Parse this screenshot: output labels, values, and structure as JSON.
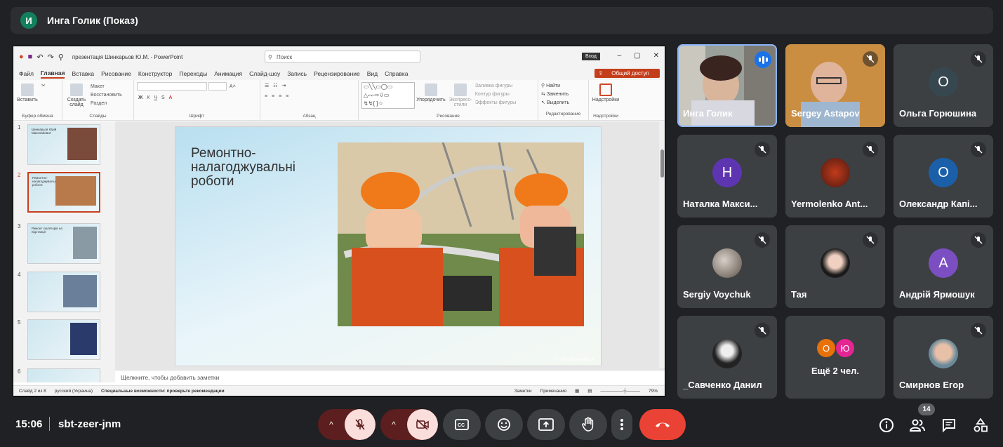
{
  "presenter_bar": {
    "avatar_letter": "И",
    "title": "Инга Голик (Показ)"
  },
  "powerpoint": {
    "doc_title": "презентація Шинкарьов Ю.М. - PowerPoint",
    "search_placeholder": "Поиск",
    "login_label": "Вход",
    "share_label": "Общий доступ",
    "menu": [
      "Файл",
      "Главная",
      "Вставка",
      "Рисование",
      "Конструктор",
      "Переходы",
      "Анимация",
      "Слайд-шоу",
      "Запись",
      "Рецензирование",
      "Вид",
      "Справка"
    ],
    "active_menu_index": 1,
    "ribbon": {
      "clipboard": {
        "paste": "Вставить",
        "label": "Буфер обмена"
      },
      "slides": {
        "create": "Создать слайд",
        "layout": "Макет",
        "restore": "Восстановить",
        "section": "Раздел",
        "label": "Слайды"
      },
      "font": {
        "label": "Шрифт"
      },
      "paragraph": {
        "label": "Абзац"
      },
      "drawing": {
        "arrange": "Упорядочить",
        "express": "Экспресс-стили",
        "fill": "Заливка фигуры",
        "outline": "Контур фигуры",
        "effects": "Эффекты фигуры",
        "label": "Рисование"
      },
      "editing": {
        "find": "Найти",
        "replace": "Заменить",
        "select": "Выделить",
        "label": "Редактирование"
      },
      "addins": {
        "btn": "Надстройки",
        "label": "Надстройки"
      }
    },
    "thumbnails": [
      {
        "num": "1",
        "text": "Шинкарьов Юрій Миколайович"
      },
      {
        "num": "2",
        "text": "Ремонтно-налагоджувальні роботи"
      },
      {
        "num": "3",
        "text": "Ремонт ізоляторів на підстанції"
      },
      {
        "num": "4",
        "text": ""
      },
      {
        "num": "5",
        "text": ""
      },
      {
        "num": "6",
        "text": ""
      }
    ],
    "selected_thumb": 1,
    "slide_title": "Ремонтно-налагоджувальні роботи",
    "watermark": "© shutterstock",
    "notes_placeholder": "Щелкните, чтобы добавить заметки",
    "status": {
      "slide": "Слайд 2 из 8",
      "lang": "русский (Украина)",
      "accessibility": "Специальные возможности: проверьте рекомендации",
      "notes": "Заметки",
      "comments": "Примечания",
      "zoom": "79%"
    }
  },
  "participants": [
    {
      "name": "Инга Голик",
      "type": "video",
      "speaking": true
    },
    {
      "name": "Sergey Astapov",
      "type": "video",
      "muted": true
    },
    {
      "name": "Ольга Горюшина",
      "type": "letter",
      "letter": "О",
      "color": "#37474f",
      "muted": true
    },
    {
      "name": "Наталка Макси...",
      "type": "letter",
      "letter": "Н",
      "color": "#5e35b1",
      "muted": true
    },
    {
      "name": "Yermolenko Ant...",
      "type": "photo",
      "muted": true
    },
    {
      "name": "Олександр Капі...",
      "type": "letter",
      "letter": "О",
      "color": "#1a5fa8",
      "muted": true
    },
    {
      "name": "Sergiy Voychuk",
      "type": "photo",
      "muted": true
    },
    {
      "name": "Тая",
      "type": "photo",
      "muted": true
    },
    {
      "name": "Андрій Ярмошук",
      "type": "letter",
      "letter": "А",
      "color": "#7b4ec2",
      "muted": true
    },
    {
      "name": "_Савченко Данил",
      "type": "photo",
      "muted": true
    },
    {
      "name": "Ещё 2 чел.",
      "type": "more",
      "letters": [
        "О",
        "Ю"
      ]
    },
    {
      "name": "Смирнов Егор",
      "type": "photo",
      "muted": true
    }
  ],
  "meeting": {
    "time": "15:06",
    "code": "sbt-zeer-jnm",
    "participant_count": "14"
  },
  "colors": {
    "accent_red": "#ea4335",
    "pp_accent": "#c43e1c",
    "speaking_blue": "#1a73e8"
  }
}
